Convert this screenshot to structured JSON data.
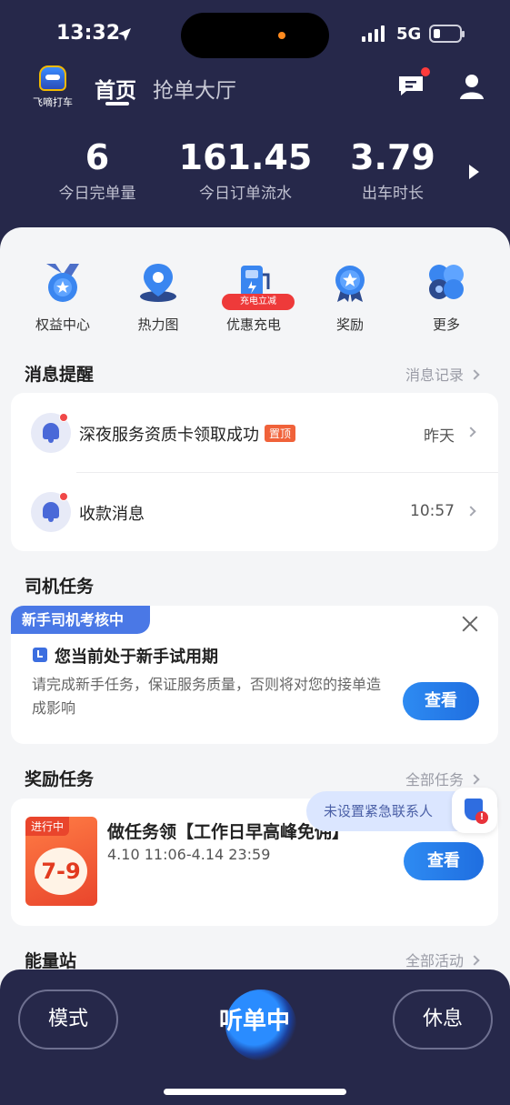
{
  "status_bar": {
    "time": "13:32",
    "network": "5G"
  },
  "header": {
    "logo_text": "飞嘀打车",
    "tabs": [
      {
        "label": "首页",
        "active": true
      },
      {
        "label": "抢单大厅",
        "active": false
      }
    ]
  },
  "stats": [
    {
      "value": "6",
      "label": "今日完单量"
    },
    {
      "value": "161.45",
      "label": "今日订单流水"
    },
    {
      "value": "3.79",
      "label": "出车时长"
    }
  ],
  "quick_actions": [
    {
      "label": "权益中心",
      "icon": "medal-star-icon"
    },
    {
      "label": "热力图",
      "icon": "map-pin-icon"
    },
    {
      "label": "优惠充电",
      "icon": "charging-station-icon",
      "badge": "充电立减"
    },
    {
      "label": "奖励",
      "icon": "award-ribbon-icon"
    },
    {
      "label": "更多",
      "icon": "more-circles-icon"
    }
  ],
  "messages": {
    "title": "消息提醒",
    "link": "消息记录",
    "items": [
      {
        "text": "深夜服务资质卡领取成功",
        "badge": "置顶",
        "time": "昨天"
      },
      {
        "text": "收款消息",
        "time": "10:57"
      }
    ]
  },
  "driver_tasks": {
    "title": "司机任务",
    "tag": "新手司机考核中",
    "heading": "您当前处于新手试用期",
    "desc": "请完成新手任务，保证服务质量，否则将对您的接单造成影响",
    "button": "查看"
  },
  "reward_tasks": {
    "title": "奖励任务",
    "link": "全部任务",
    "item": {
      "status": "进行中",
      "image_text": "7-9",
      "title": "做任务领【工作日早高峰免佣】",
      "time": "4.10 11:06-4.14 23:59",
      "button": "查看"
    }
  },
  "emergency": {
    "text": "未设置紧急联系人",
    "alert": "!"
  },
  "energy": {
    "title": "能量站",
    "link": "全部活动"
  },
  "bottom_bar": {
    "mode": "模式",
    "listening": "听单中",
    "rest": "休息"
  },
  "colors": {
    "header_bg": "#26284a",
    "primary": "#2e7cf0",
    "alert": "#f04848"
  }
}
